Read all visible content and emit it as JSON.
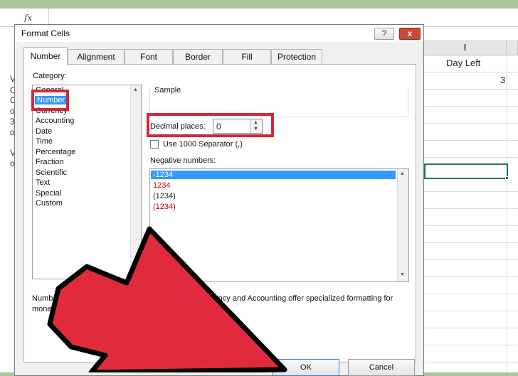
{
  "spreadsheet": {
    "fx_label": "fx",
    "column_header": "I",
    "column_title": "Day Left",
    "cell_value": "3",
    "left_edge_letters": [
      "V",
      "C",
      "C",
      "o",
      "3",
      "o",
      "V",
      "o"
    ],
    "accent_color": "#217346"
  },
  "dialog": {
    "title": "Format Cells",
    "help_label": "?",
    "close_label": "x",
    "tabs": [
      {
        "label": "Number",
        "active": true
      },
      {
        "label": "Alignment",
        "active": false
      },
      {
        "label": "Font",
        "active": false
      },
      {
        "label": "Border",
        "active": false
      },
      {
        "label": "Fill",
        "active": false
      },
      {
        "label": "Protection",
        "active": false
      }
    ],
    "category_label": "Category:",
    "categories": [
      "General",
      "Number",
      "Currency",
      "Accounting",
      "Date",
      "Time",
      "Percentage",
      "Fraction",
      "Scientific",
      "Text",
      "Special",
      "Custom"
    ],
    "selected_category": "Number",
    "sample_label": "Sample",
    "decimal_places_label": "Decimal places:",
    "decimal_places_value": "0",
    "separator_label": "Use 1000 Separator (,)",
    "separator_checked": false,
    "negative_numbers_label": "Negative numbers:",
    "negative_numbers": [
      {
        "text": "-1234",
        "red": false,
        "selected": true
      },
      {
        "text": "1234",
        "red": true,
        "selected": false
      },
      {
        "text": "(1234)",
        "red": false,
        "selected": false
      },
      {
        "text": "(1234)",
        "red": true,
        "selected": false
      }
    ],
    "description_line1": "Number is used for general display of numbers. Currency and Accounting offer specialized formatting for",
    "description_line2": "monetary value.",
    "ok_label": "OK",
    "cancel_label": "Cancel",
    "highlight_color": "#d1283a",
    "selection_color": "#3399ff"
  }
}
